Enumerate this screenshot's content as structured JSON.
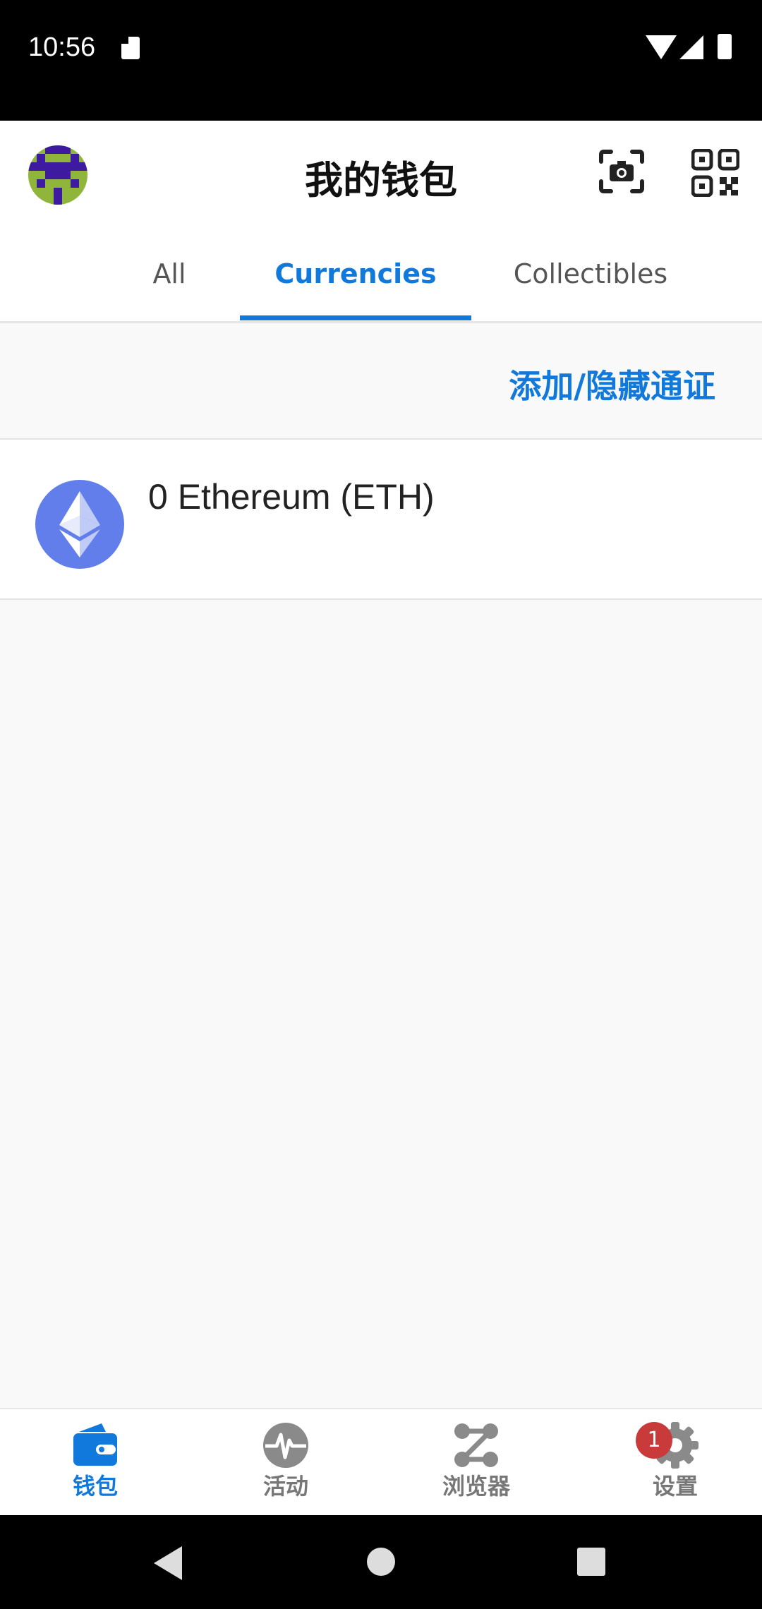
{
  "status_bar": {
    "time": "10:56"
  },
  "header": {
    "title": "我的钱包"
  },
  "tabs": [
    {
      "label": "All"
    },
    {
      "label": "Currencies",
      "active": true
    },
    {
      "label": "Collectibles"
    }
  ],
  "actions": {
    "add_hide_tokens": "添加/隐藏通证"
  },
  "assets": [
    {
      "text": "0 Ethereum (ETH)",
      "icon": "ethereum-icon"
    }
  ],
  "bottom_nav": [
    {
      "label": "钱包",
      "icon": "wallet-icon",
      "active": true
    },
    {
      "label": "活动",
      "icon": "activity-icon"
    },
    {
      "label": "浏览器",
      "icon": "browser-icon"
    },
    {
      "label": "设置",
      "icon": "settings-icon",
      "badge": "1"
    }
  ],
  "colors": {
    "accent": "#1279dc",
    "badge": "#c93a3a",
    "eth": "#627eea"
  }
}
